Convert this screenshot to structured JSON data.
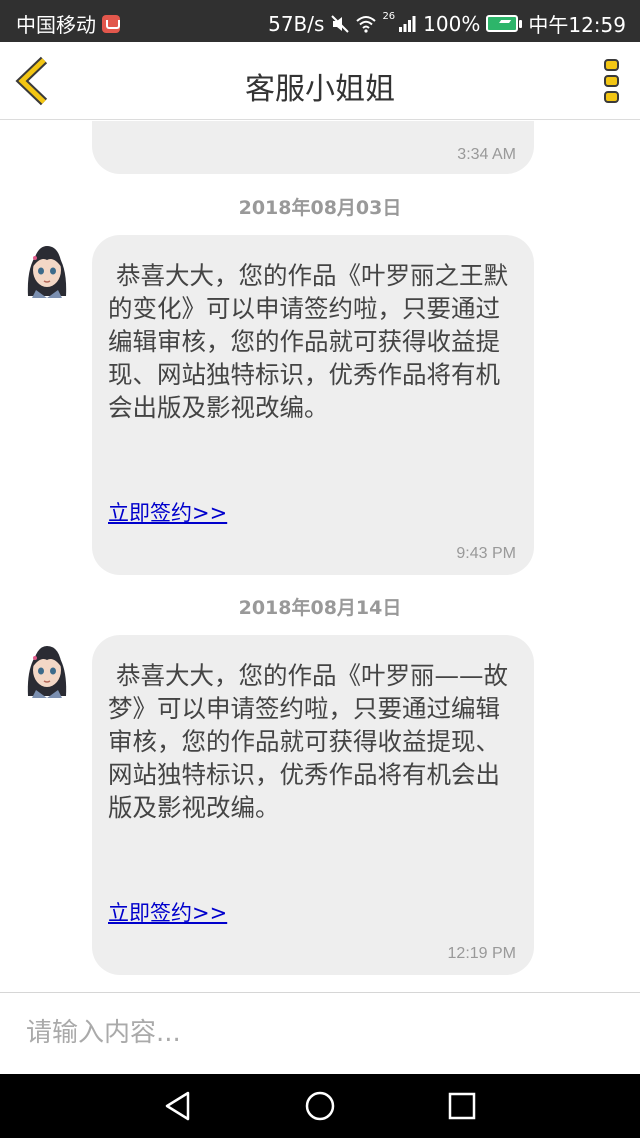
{
  "status_bar": {
    "carrier": "中国移动",
    "speed": "57B/s",
    "network": "26",
    "battery": "100%",
    "time": "中午12:59"
  },
  "header": {
    "title": "客服小姐姐",
    "back_icon": "chevron-left-icon",
    "menu_icon": "vertical-dots-icon",
    "accent_color": "#f3c614"
  },
  "messages": [
    {
      "text": "",
      "link": "",
      "time": "3:34 AM"
    },
    {
      "date": "2018年08月03日",
      "text": "恭喜大大，您的作品《叶罗丽之王默的变化》可以申请签约啦，只要通过编辑审核，您的作品就可获得收益提现、网站独特标识，优秀作品将有机会出版及影视改编。",
      "link": "立即签约>>",
      "time": "9:43 PM"
    },
    {
      "date": "2018年08月14日",
      "text": "恭喜大大，您的作品《叶罗丽——故梦》可以申请签约啦，只要通过编辑审核，您的作品就可获得收益提现、网站独特标识，优秀作品将有机会出版及影视改编。",
      "link": "立即签约>>",
      "time": "12:19 PM"
    }
  ],
  "input": {
    "placeholder": "请输入内容..."
  },
  "nav_bar": {
    "back": "triangle-back-icon",
    "home": "circle-home-icon",
    "recents": "square-recents-icon"
  }
}
